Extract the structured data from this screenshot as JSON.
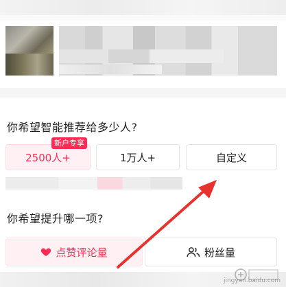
{
  "question_reach": "你希望智能推荐给多少人?",
  "reach_options": [
    {
      "label": "2500人+",
      "selected": true,
      "badge": "新户专享"
    },
    {
      "label": "1万人+",
      "selected": false
    },
    {
      "label": "自定义",
      "selected": false
    }
  ],
  "question_goal": "你希望提升哪一项?",
  "goal_options": [
    {
      "label": "点赞评论量",
      "icon": "heart-icon",
      "selected": true
    },
    {
      "label": "粉丝量",
      "icon": "users-icon",
      "selected": false
    }
  ],
  "watermark_domain": "jingyan.baidu.com",
  "colors": {
    "accent": "#fe2c55",
    "selected_bg": "#fff1f3",
    "annotation_arrow": "#e8322e"
  }
}
